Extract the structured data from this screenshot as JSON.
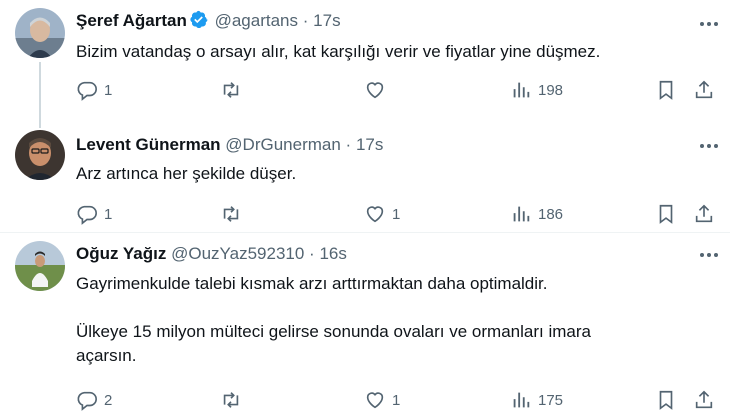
{
  "tweets": [
    {
      "name": "Şeref Ağartan",
      "verified": true,
      "handle": "@agartans",
      "dot": "·",
      "time": "17s",
      "lines": [
        "Bizim vatandaş o arsayı alır, kat karşılığı verir ve fiyatlar yine düşmez."
      ],
      "replies": "1",
      "retweets": "",
      "likes": "",
      "views": "198"
    },
    {
      "name": "Levent Günerman",
      "verified": false,
      "handle": "@DrGunerman",
      "dot": "·",
      "time": "17s",
      "lines": [
        "Arz artınca her şekilde düşer."
      ],
      "replies": "1",
      "retweets": "",
      "likes": "1",
      "views": "186"
    },
    {
      "name": "Oğuz Yağız",
      "verified": false,
      "handle": "@OuzYaz592310",
      "dot": "·",
      "time": "16s",
      "lines": [
        "Gayrimenkulde talebi kısmak arzı arttırmaktan daha optimaldir.",
        "Ülkeye 15 milyon mülteci gelirse sonunda ovaları ve ormanları imara",
        "açarsın."
      ],
      "replies": "2",
      "retweets": "",
      "likes": "1",
      "views": "175"
    }
  ],
  "icons": {
    "reply": "reply-icon",
    "retweet": "retweet-icon",
    "like": "heart-icon",
    "views": "views-icon",
    "bookmark": "bookmark-icon",
    "share": "share-icon",
    "more": "more-icon",
    "verified": "verified-badge-icon"
  },
  "colors": {
    "text": "#0f1419",
    "secondary": "#536471",
    "verified": "#1d9bf0",
    "thread_line": "#cfd9de"
  }
}
